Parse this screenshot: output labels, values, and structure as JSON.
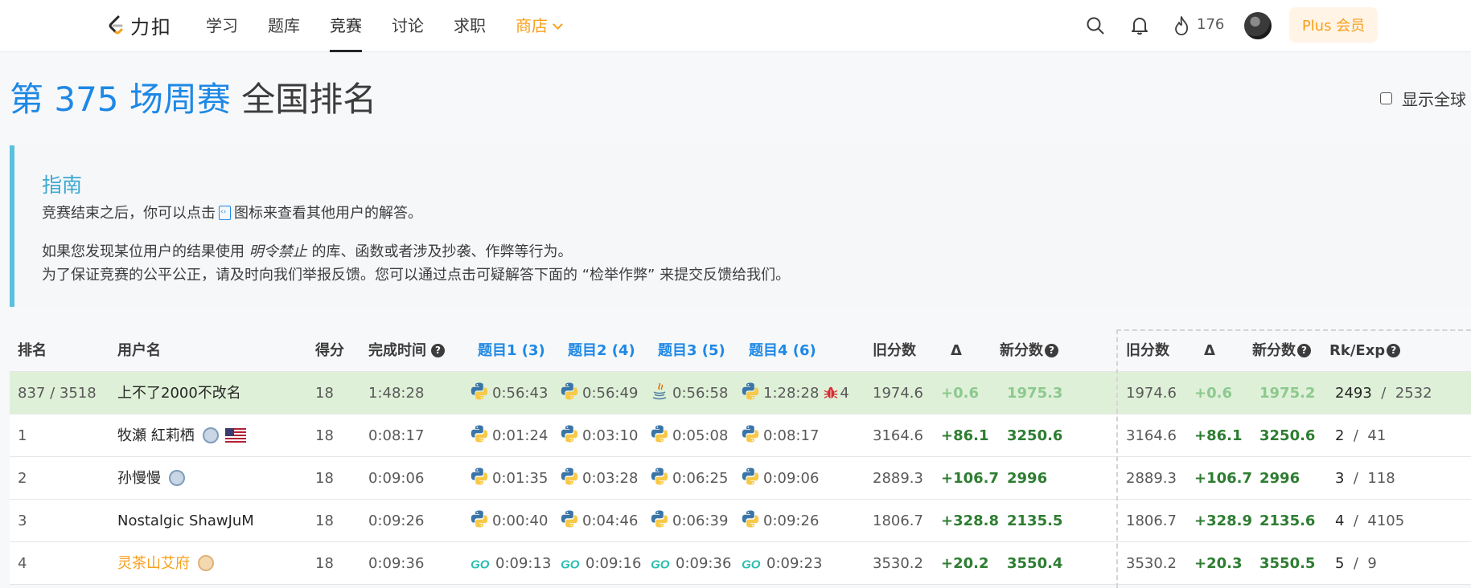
{
  "nav": {
    "logo_text": "力扣",
    "items": [
      "学习",
      "题库",
      "竞赛",
      "讨论",
      "求职"
    ],
    "shop": "商店",
    "streak": "176",
    "plus": "Plus 会员"
  },
  "title": {
    "part_blue": "第 375 场周赛",
    "part_gray": "全国排名"
  },
  "global_toggle": "显示全球",
  "guide": {
    "title": "指南",
    "line1_a": "竞赛结束之后，你可以点击",
    "line1_b": "图标来查看其他用户的解答。",
    "line2_a": "如果您发现某位用户的结果使用",
    "line2_em": "明令禁止",
    "line2_b": "的库、函数或者涉及抄袭、作弊等行为。",
    "line3": "为了保证竞赛的公平公正，请及时向我们举报反馈。您可以通过点击可疑解答下面的 “检举作弊” 来提交反馈给我们。"
  },
  "table": {
    "headers": {
      "rank": "排名",
      "username": "用户名",
      "score": "得分",
      "finish_time": "完成时间",
      "q1": "题目1 (3)",
      "q2": "题目2 (4)",
      "q3": "题目3 (5)",
      "q4": "题目4 (6)",
      "old_rating": "旧分数",
      "delta": "Δ",
      "new_rating": "新分数",
      "old_rating2": "旧分数",
      "delta2": "Δ",
      "new_rating2": "新分数",
      "rk_exp": "Rk/Exp"
    },
    "rows": [
      {
        "rank": "837 / 3518",
        "username": "上不了2000不改名",
        "score": "18",
        "time": "1:48:28",
        "q1": "0:56:43",
        "q2": "0:56:49",
        "q3": "0:56:58",
        "q4": "1:28:28",
        "q4_bugs": "4",
        "old": "1974.6",
        "delta": "+0.6",
        "new": "1975.3",
        "old2": "1974.6",
        "delta2": "+0.6",
        "new2": "1975.2",
        "rk": "2493",
        "exp": "2532"
      },
      {
        "rank": "1",
        "username": "牧瀬 紅莉栖",
        "score": "18",
        "time": "0:08:17",
        "q1": "0:01:24",
        "q2": "0:03:10",
        "q3": "0:05:08",
        "q4": "0:08:17",
        "old": "3164.6",
        "delta": "+86.1",
        "new": "3250.6",
        "old2": "3164.6",
        "delta2": "+86.1",
        "new2": "3250.6",
        "rk": "2",
        "exp": "41"
      },
      {
        "rank": "2",
        "username": "孙慢慢",
        "score": "18",
        "time": "0:09:06",
        "q1": "0:01:35",
        "q2": "0:03:28",
        "q3": "0:06:25",
        "q4": "0:09:06",
        "old": "2889.3",
        "delta": "+106.7",
        "new": "2996",
        "old2": "2889.3",
        "delta2": "+106.7",
        "new2": "2996",
        "rk": "3",
        "exp": "118"
      },
      {
        "rank": "3",
        "username": "Nostalgic ShawJuM",
        "score": "18",
        "time": "0:09:26",
        "q1": "0:00:40",
        "q2": "0:04:46",
        "q3": "0:06:39",
        "q4": "0:09:26",
        "old": "1806.7",
        "delta": "+328.8",
        "new": "2135.5",
        "old2": "1806.7",
        "delta2": "+328.9",
        "new2": "2135.6",
        "rk": "4",
        "exp": "4105"
      },
      {
        "rank": "4",
        "username": "灵茶山艾府",
        "score": "18",
        "time": "0:09:36",
        "q1": "0:09:13",
        "q2": "0:09:16",
        "q3": "0:09:36",
        "q4": "0:09:23",
        "old": "3530.2",
        "delta": "+20.2",
        "new": "3550.4",
        "old2": "3530.2",
        "delta2": "+20.3",
        "new2": "3550.5",
        "rk": "5",
        "exp": "9"
      }
    ]
  },
  "colors": {
    "accent_blue": "#1e88e5",
    "shop_orange": "#f89f1b",
    "positive_green": "#2e7d32",
    "my_row_bg": "#dff0d8"
  }
}
